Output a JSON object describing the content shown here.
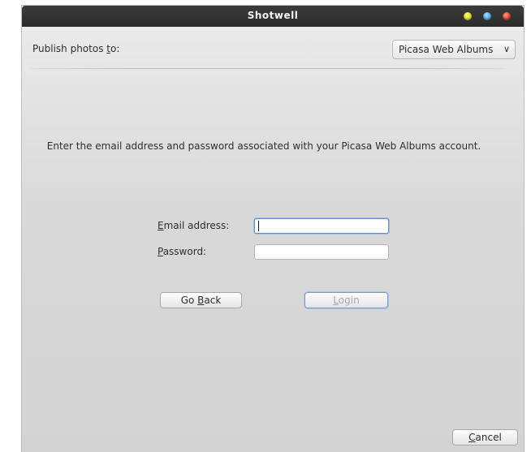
{
  "window": {
    "title": "Shotwell",
    "controls": [
      "minimize",
      "maximize",
      "close"
    ]
  },
  "publish": {
    "label_prefix": "Publish photos ",
    "label_access": "t",
    "label_suffix": "o:",
    "service_selected": "Picasa Web Albums"
  },
  "instruction": "Enter the email address and password associated with your Picasa Web Albums account.",
  "form": {
    "email_label_access": "E",
    "email_label_rest": "mail address:",
    "email_value": "",
    "password_label_access": "P",
    "password_label_rest": "assword:",
    "password_value": ""
  },
  "buttons": {
    "go_back_prefix": "Go ",
    "go_back_access": "B",
    "go_back_suffix": "ack",
    "login_access": "L",
    "login_rest": "ogin",
    "cancel_access": "C",
    "cancel_rest": "ancel"
  },
  "colors": {
    "titlebar": "#2f2f2f",
    "minimize": "#e8e41a",
    "maximize": "#57aee0",
    "close": "#e2432f",
    "focus": "#6a8fc4"
  }
}
